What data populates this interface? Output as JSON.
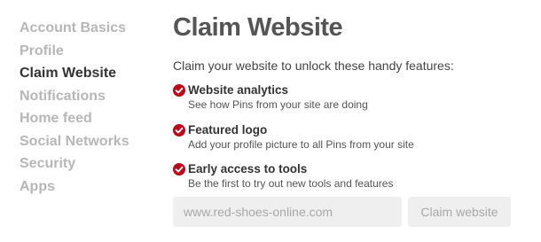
{
  "sidebar": {
    "items": [
      {
        "label": "Account Basics"
      },
      {
        "label": "Profile"
      },
      {
        "label": "Claim Website",
        "active": true
      },
      {
        "label": "Notifications"
      },
      {
        "label": "Home feed"
      },
      {
        "label": "Social Networks"
      },
      {
        "label": "Security"
      },
      {
        "label": "Apps"
      }
    ]
  },
  "main": {
    "title": "Claim Website",
    "intro": "Claim your website to unlock these handy features:",
    "features": [
      {
        "title": "Website analytics",
        "description": "See how Pins from your site are doing",
        "icon": "check-circle-icon"
      },
      {
        "title": "Featured logo",
        "description": "Add your profile picture to all Pins from your site",
        "icon": "check-circle-icon"
      },
      {
        "title": "Early access to tools",
        "description": "Be the first to try out new tools and features",
        "icon": "check-circle-icon"
      }
    ],
    "website_input": {
      "placeholder": "www.red-shoes-online.com",
      "value": ""
    },
    "claim_button_label": "Claim website"
  },
  "colors": {
    "accent": "#bd081c",
    "sidebar_inactive": "#b7b7b7",
    "sidebar_active": "#333333",
    "disabled_bg": "#efefef",
    "disabled_text": "#a8a8a8"
  }
}
